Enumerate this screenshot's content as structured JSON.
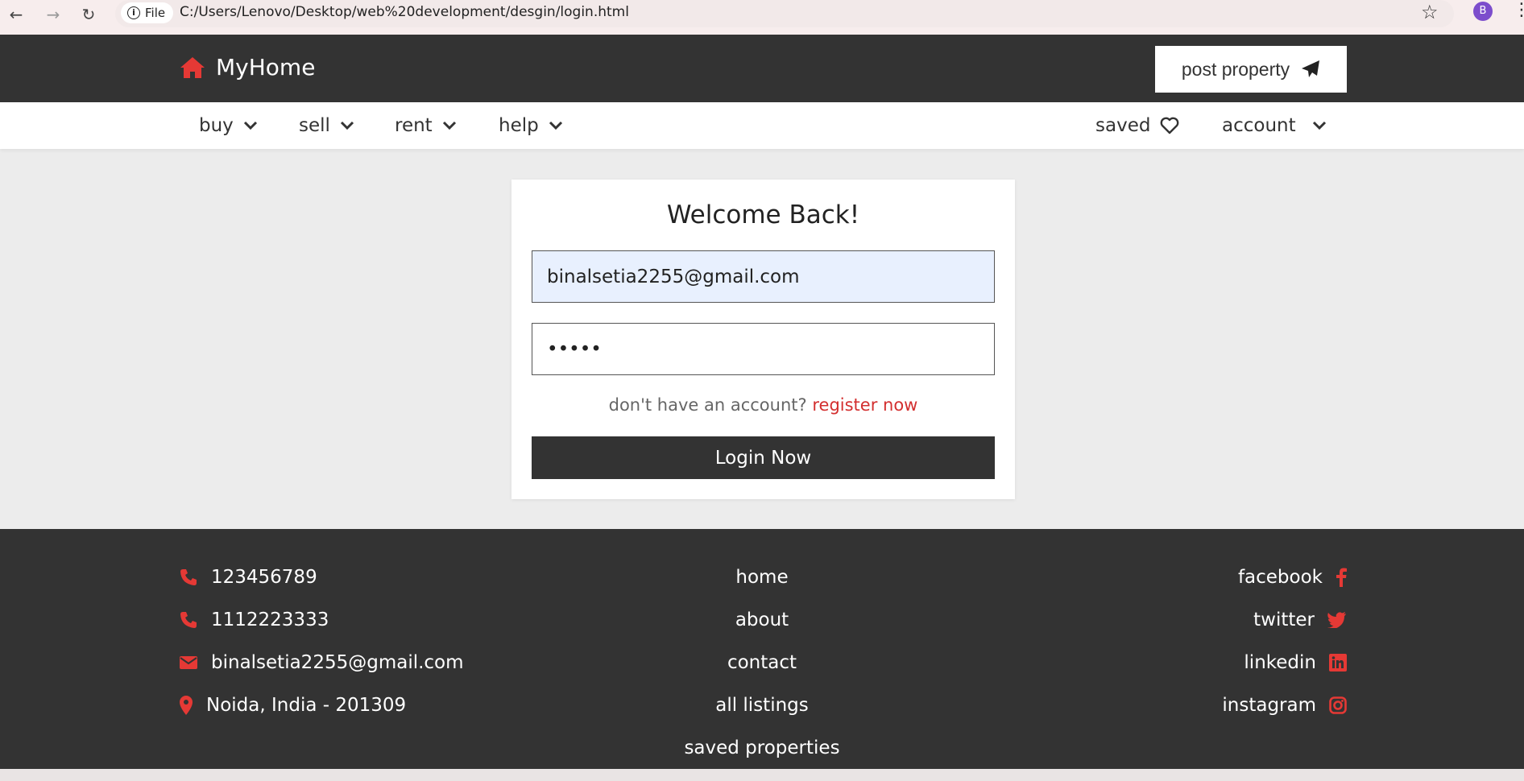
{
  "browser": {
    "file_label": "File",
    "url": "C:/Users/Lenovo/Desktop/web%20development/desgin/login.html",
    "profile_initial": "B"
  },
  "header": {
    "logo_text": "MyHome",
    "logo_icon": "home-icon",
    "post_property_label": "post property",
    "post_property_icon": "paper-plane-icon",
    "accent_color": "#e53935"
  },
  "nav": {
    "left_items": [
      {
        "label": "buy"
      },
      {
        "label": "sell"
      },
      {
        "label": "rent"
      },
      {
        "label": "help"
      }
    ],
    "saved_label": "saved",
    "account_label": "account"
  },
  "login": {
    "title": "Welcome Back!",
    "email_value": "binalsetia2255@gmail.com",
    "password_value": "•••••",
    "register_prompt": "don't have an account?",
    "register_link": "register now",
    "submit_label": "Login Now"
  },
  "footer": {
    "contacts": [
      {
        "icon": "phone-icon",
        "text": "123456789"
      },
      {
        "icon": "phone-icon",
        "text": "1112223333"
      },
      {
        "icon": "envelope-icon",
        "text": "binalsetia2255@gmail.com"
      },
      {
        "icon": "location-pin-icon",
        "text": "Noida, India - 201309"
      }
    ],
    "links": [
      {
        "text": "home"
      },
      {
        "text": "about"
      },
      {
        "text": "contact"
      },
      {
        "text": "all listings"
      },
      {
        "text": "saved properties"
      }
    ],
    "social": [
      {
        "icon": "facebook-icon",
        "text": "facebook"
      },
      {
        "icon": "twitter-icon",
        "text": "twitter"
      },
      {
        "icon": "linkedin-icon",
        "text": "linkedin"
      },
      {
        "icon": "instagram-icon",
        "text": "instagram"
      }
    ]
  }
}
